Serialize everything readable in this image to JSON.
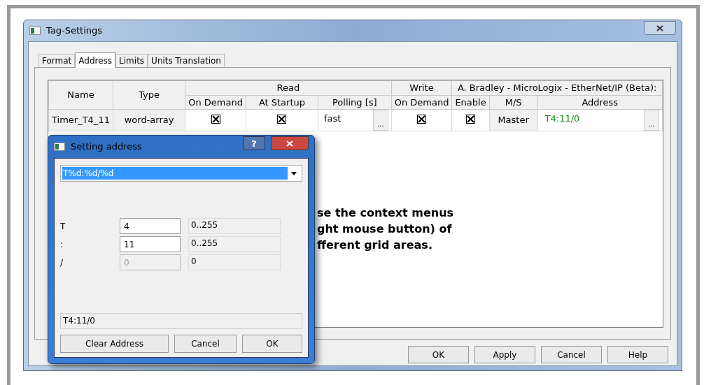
{
  "window": {
    "title": "Tag-Settings"
  },
  "tabs": [
    {
      "label": "Format",
      "selected": false
    },
    {
      "label": "Address",
      "selected": true
    },
    {
      "label": "Limits",
      "selected": false
    },
    {
      "label": "Units Translation",
      "selected": false
    }
  ],
  "table": {
    "header_groups": [
      {
        "label": "Name"
      },
      {
        "label": "Type"
      },
      {
        "label": "Read",
        "columns": [
          "On Demand",
          "At Startup",
          "Polling [s]"
        ]
      },
      {
        "label": "Write",
        "columns": [
          "On Demand"
        ]
      },
      {
        "label": "A. Bradley - MicroLogix - EtherNet/IP (Beta):",
        "columns": [
          "Enable",
          "M/S",
          "Address"
        ]
      }
    ],
    "rows": [
      {
        "name": "Timer_T4_11",
        "type": "word-array",
        "read_on_demand": {
          "checked": true
        },
        "read_at_startup": {
          "checked": true
        },
        "polling": "fast",
        "polling_button": "...",
        "write_on_demand": {
          "checked": true
        },
        "enable": {
          "checked": true
        },
        "ms": "Master",
        "address": "T4:11/0",
        "address_button": "..."
      }
    ]
  },
  "hint_lines": [
    "se the context menus",
    "ght mouse button) of",
    "fferent grid areas."
  ],
  "buttons": [
    "OK",
    "Apply",
    "Cancel",
    "Help"
  ],
  "dialog": {
    "title": "Setting address",
    "help_button": "?",
    "format": "T%d:%d/%d",
    "fields": [
      {
        "label": "T",
        "value": "4",
        "range": "0..255",
        "disabled": false
      },
      {
        "label": ":",
        "value": "11",
        "range": "0..255",
        "disabled": false
      },
      {
        "label": "/",
        "value": "0",
        "range": "0",
        "disabled": true
      }
    ],
    "result": "T4:11/0",
    "buttons": [
      "Clear Address",
      "Cancel",
      "OK"
    ]
  }
}
